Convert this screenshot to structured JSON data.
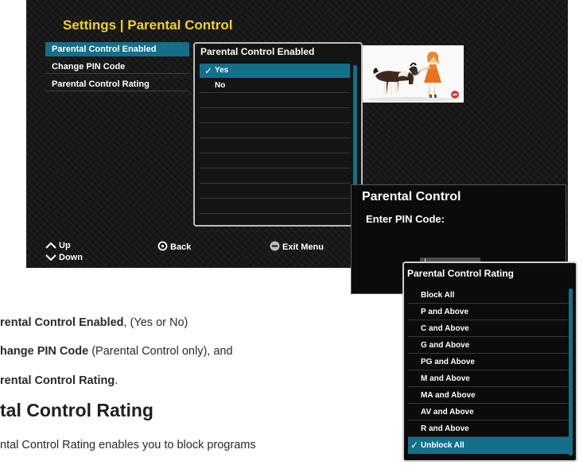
{
  "screen": {
    "title": "Settings | Parental Control",
    "menu": [
      {
        "label": "Parental Control Enabled",
        "selected": true
      },
      {
        "label": "Change PIN Code",
        "selected": false
      },
      {
        "label": "Parental Control Rating",
        "selected": false
      }
    ],
    "panel": {
      "title": "Parental Control Enabled",
      "options": [
        {
          "label": "Yes",
          "checked": true,
          "check": "✓"
        },
        {
          "label": "No",
          "checked": false,
          "check": ""
        }
      ]
    },
    "hints": {
      "up": "Up",
      "down": "Down",
      "back": "Back",
      "exit": "Exit Menu"
    }
  },
  "doc": {
    "line1_bold": "rental Control Enabled",
    "line1_rest": ", (Yes or No)",
    "line2_bold": "hange PIN Code",
    "line2_rest": " (Parental Control only), and",
    "line3_bold": "rental Control Rating",
    "line3_rest": ".",
    "heading": "tal Control Rating",
    "para": "ntal Control Rating enables you to  block programs"
  },
  "pin_popup": {
    "title": "Parental Control",
    "label": "Enter PIN Code:"
  },
  "rating_popup": {
    "title": "Parental Control Rating",
    "items": [
      {
        "label": "Block All",
        "checked": false
      },
      {
        "label": "P and Above",
        "checked": false
      },
      {
        "label": "C and Above",
        "checked": false
      },
      {
        "label": "G and Above",
        "checked": false
      },
      {
        "label": "PG and Above",
        "checked": false
      },
      {
        "label": "M and Above",
        "checked": false
      },
      {
        "label": "MA and Above",
        "checked": false
      },
      {
        "label": "AV and Above",
        "checked": false
      },
      {
        "label": "R and Above",
        "checked": false
      },
      {
        "label": "Unblock All",
        "checked": true
      }
    ],
    "check": "✓"
  },
  "colors": {
    "title_yellow": "#f2d21b",
    "highlight_teal": "#146f8a",
    "panel_bg": "#141414"
  }
}
